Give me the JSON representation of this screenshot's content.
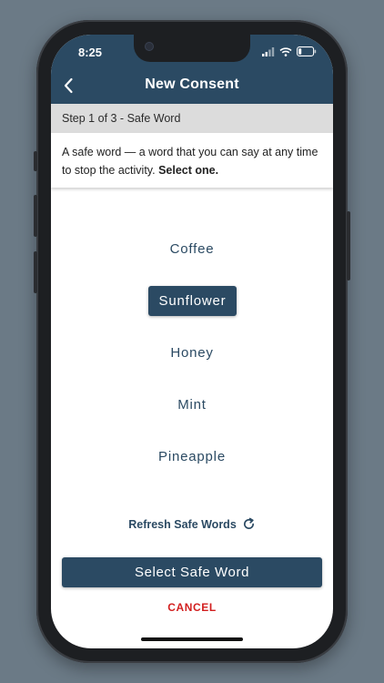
{
  "status_bar": {
    "time": "8:25"
  },
  "header": {
    "title": "New Consent"
  },
  "step": {
    "label": "Step 1 of 3 - Safe Word"
  },
  "description": {
    "text": "A safe word — a word that you can say at any time to stop the activity.",
    "emphasis": "Select one."
  },
  "safe_words": {
    "items": [
      {
        "label": "Coffee",
        "selected": false
      },
      {
        "label": "Sunflower",
        "selected": true
      },
      {
        "label": "Honey",
        "selected": false
      },
      {
        "label": "Mint",
        "selected": false
      },
      {
        "label": "Pineapple",
        "selected": false
      }
    ]
  },
  "refresh": {
    "label": "Refresh Safe Words",
    "icon": "refresh-icon"
  },
  "actions": {
    "select_label": "Select Safe Word",
    "cancel_label": "CANCEL"
  },
  "colors": {
    "primary": "#2b4a63",
    "cancel": "#d21f1f",
    "step_bar": "#dcdcdc"
  }
}
